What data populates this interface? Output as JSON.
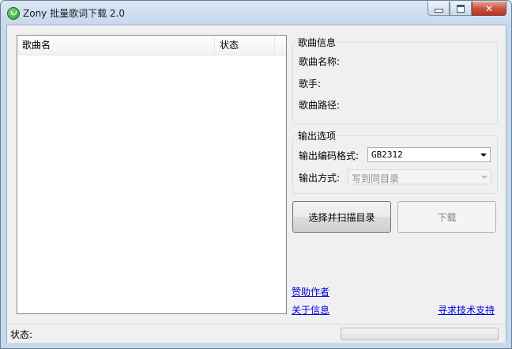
{
  "window": {
    "title": "Zony 批量歌词下载 2.0",
    "icon": "app-logo-icon",
    "controls": {
      "minimize": "minimize-icon",
      "maximize": "maximize-icon",
      "close": "close-icon"
    }
  },
  "song_list": {
    "columns": [
      "歌曲名",
      "状态"
    ],
    "rows": []
  },
  "song_info": {
    "legend": "歌曲信息",
    "name_label": "歌曲名称:",
    "artist_label": "歌手:",
    "path_label": "歌曲路径:"
  },
  "output": {
    "legend": "输出选项",
    "encoding_label": "输出编码格式:",
    "encoding_value": "GB2312",
    "method_label": "输出方式:",
    "method_value": "写到同目录"
  },
  "buttons": {
    "scan": "选择并扫描目录",
    "download": "下载"
  },
  "links": {
    "donate": "赞助作者",
    "about": "关于信息",
    "support": "寻求技术支持"
  },
  "status": {
    "label": "状态:",
    "progress": 0
  },
  "colors": {
    "link": "#0000e0",
    "progress_fill": "#06b025"
  }
}
